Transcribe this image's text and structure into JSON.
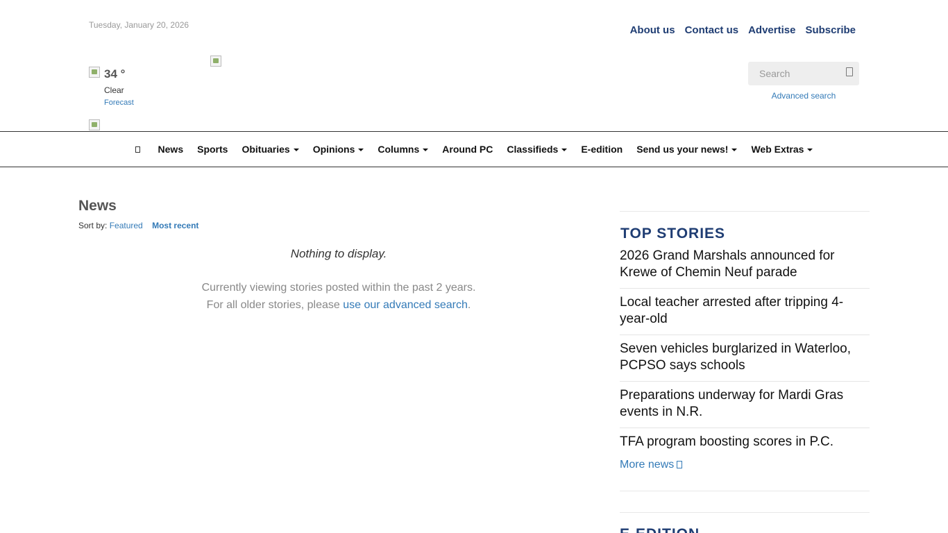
{
  "header": {
    "date": "Tuesday, January 20, 2026",
    "top_links": [
      "About us",
      "Contact us",
      "Advertise",
      "Subscribe"
    ]
  },
  "weather": {
    "temp": "34 °",
    "condition": "Clear",
    "forecast_label": "Forecast"
  },
  "search": {
    "placeholder": "Search",
    "advanced_label": "Advanced search"
  },
  "nav": {
    "items": [
      {
        "label": "News",
        "dropdown": false
      },
      {
        "label": "Sports",
        "dropdown": false
      },
      {
        "label": "Obituaries",
        "dropdown": true
      },
      {
        "label": "Opinions",
        "dropdown": true
      },
      {
        "label": "Columns",
        "dropdown": true
      },
      {
        "label": "Around PC",
        "dropdown": false
      },
      {
        "label": "Classifieds",
        "dropdown": true
      },
      {
        "label": "E-edition",
        "dropdown": false
      },
      {
        "label": "Send us your news!",
        "dropdown": true
      },
      {
        "label": "Web Extras",
        "dropdown": true
      }
    ]
  },
  "main": {
    "title": "News",
    "sort_label": "Sort by:",
    "sort_featured": "Featured",
    "sort_recent": "Most recent",
    "empty_message": "Nothing to display.",
    "viewing_line1": "Currently viewing stories posted within the past 2 years.",
    "viewing_line2_prefix": "For all older stories, please ",
    "viewing_link": "use our advanced search",
    "viewing_line2_suffix": "."
  },
  "sidebar": {
    "top_stories_title": "TOP STORIES",
    "stories": [
      "2026 Grand Marshals announced for Krewe of Chemin Neuf parade",
      "Local teacher arrested after tripping 4-year-old",
      "Seven vehicles burglarized in Waterloo, PCPSO says schools",
      "Preparations underway for Mardi Gras events in N.R.",
      "TFA program boosting scores in P.C."
    ],
    "more_news": "More news",
    "edition_title": "E-EDITION"
  },
  "colors": {
    "brand_blue": "#1f3d73",
    "link_blue": "#337ab7"
  }
}
